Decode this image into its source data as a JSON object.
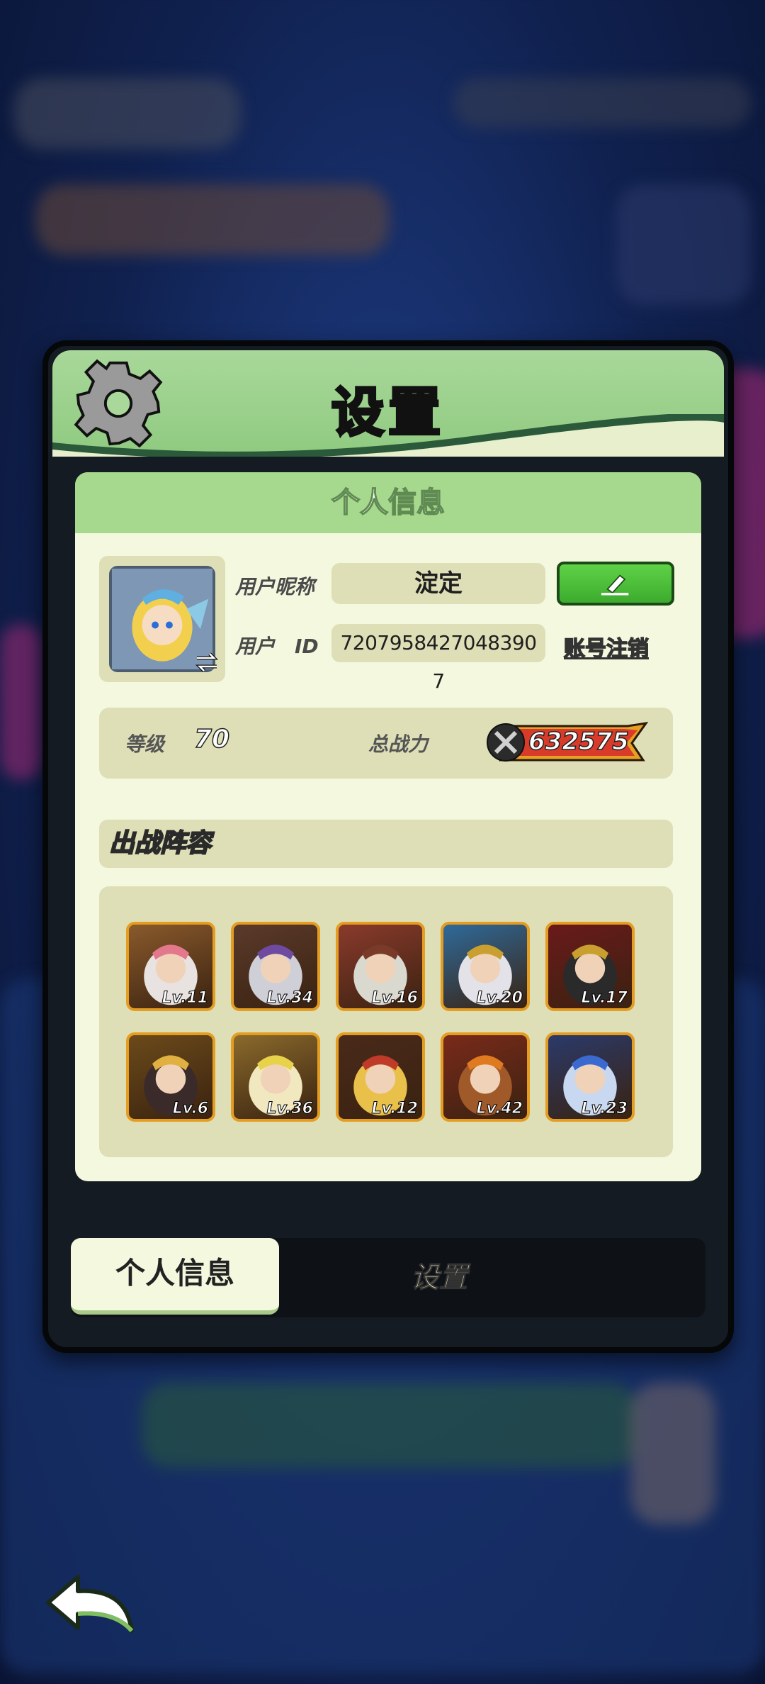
{
  "header": {
    "title": "设置"
  },
  "profile": {
    "section_title": "个人信息",
    "nickname_label": "用户昵称",
    "nickname_value": "淀定",
    "id_label": "用户　ID",
    "id_value": "7207958427048390 7",
    "cancel_account": "账号注销"
  },
  "stats": {
    "level_label": "等级",
    "level_value": "70",
    "power_label": "总战力",
    "power_value": "632575"
  },
  "lineup": {
    "title": "出战阵容",
    "heroes": [
      {
        "level": "Lv.11"
      },
      {
        "level": "Lv.34"
      },
      {
        "level": "Lv.16"
      },
      {
        "level": "Lv.20"
      },
      {
        "level": "Lv.17"
      },
      {
        "level": "Lv.6"
      },
      {
        "level": "Lv.36"
      },
      {
        "level": "Lv.12"
      },
      {
        "level": "Lv.42"
      },
      {
        "level": "Lv.23"
      }
    ]
  },
  "tabs": {
    "personal_info": "个人信息",
    "settings": "设置"
  },
  "icons": {
    "gear": "gear-icon",
    "edit": "pencil-icon",
    "swap": "swap-icon",
    "power": "crossed-swords-icon",
    "back": "back-arrow-icon"
  },
  "colors": {
    "accent_green": "#8fca80",
    "panel_cream": "#f3f8de",
    "field_beige": "#dedfb7",
    "hero_border": "#e49d21",
    "edit_green": "#3cab2e"
  }
}
